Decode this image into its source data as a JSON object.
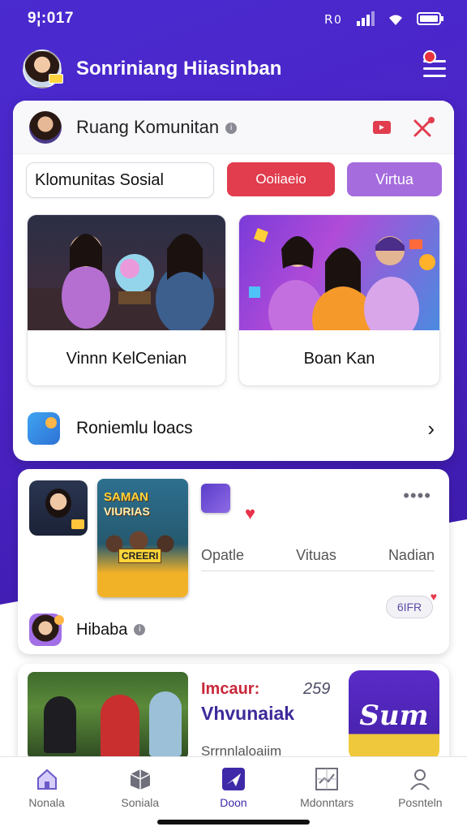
{
  "status": {
    "time": "9¦:017"
  },
  "header": {
    "title": "Sonriniang Hiiasinban"
  },
  "community": {
    "title": "Ruang Komunitan",
    "search_text": "Klomunitas Sosial",
    "pill_red": "Ooiiaeio",
    "pill_violet": "Virtua",
    "features": [
      {
        "caption": "Vinnn KelCenian"
      },
      {
        "caption": "Boan Kan"
      }
    ],
    "footer_label": "Roniemlu loacs"
  },
  "post": {
    "poster_line1": "SAMAN",
    "poster_line2": "VIURIAS",
    "poster_line3": "CREERI",
    "more": "••••",
    "tabs": [
      "Opatle",
      "Vituas",
      "Nadian"
    ],
    "gift_label": "6IFR",
    "user_name": "Hibaba"
  },
  "promo": {
    "label": "Imcaur:",
    "count": "259",
    "title": "Vhvunaiak",
    "subtitle": "Srrnnlaloaiim",
    "logo_text": "Sum"
  },
  "nav": [
    {
      "label": "Nonala",
      "icon": "home-icon"
    },
    {
      "label": "Soniala",
      "icon": "box-icon"
    },
    {
      "label": "Doon",
      "icon": "send-icon",
      "active": true
    },
    {
      "label": "Mdonntars",
      "icon": "chart-icon"
    },
    {
      "label": "Posnteln",
      "icon": "profile-icon"
    }
  ],
  "colors": {
    "brand": "#4a2bd0",
    "accent_red": "#e13d4e",
    "accent_violet": "#a56cdd",
    "active_nav": "#3e2aa8"
  }
}
